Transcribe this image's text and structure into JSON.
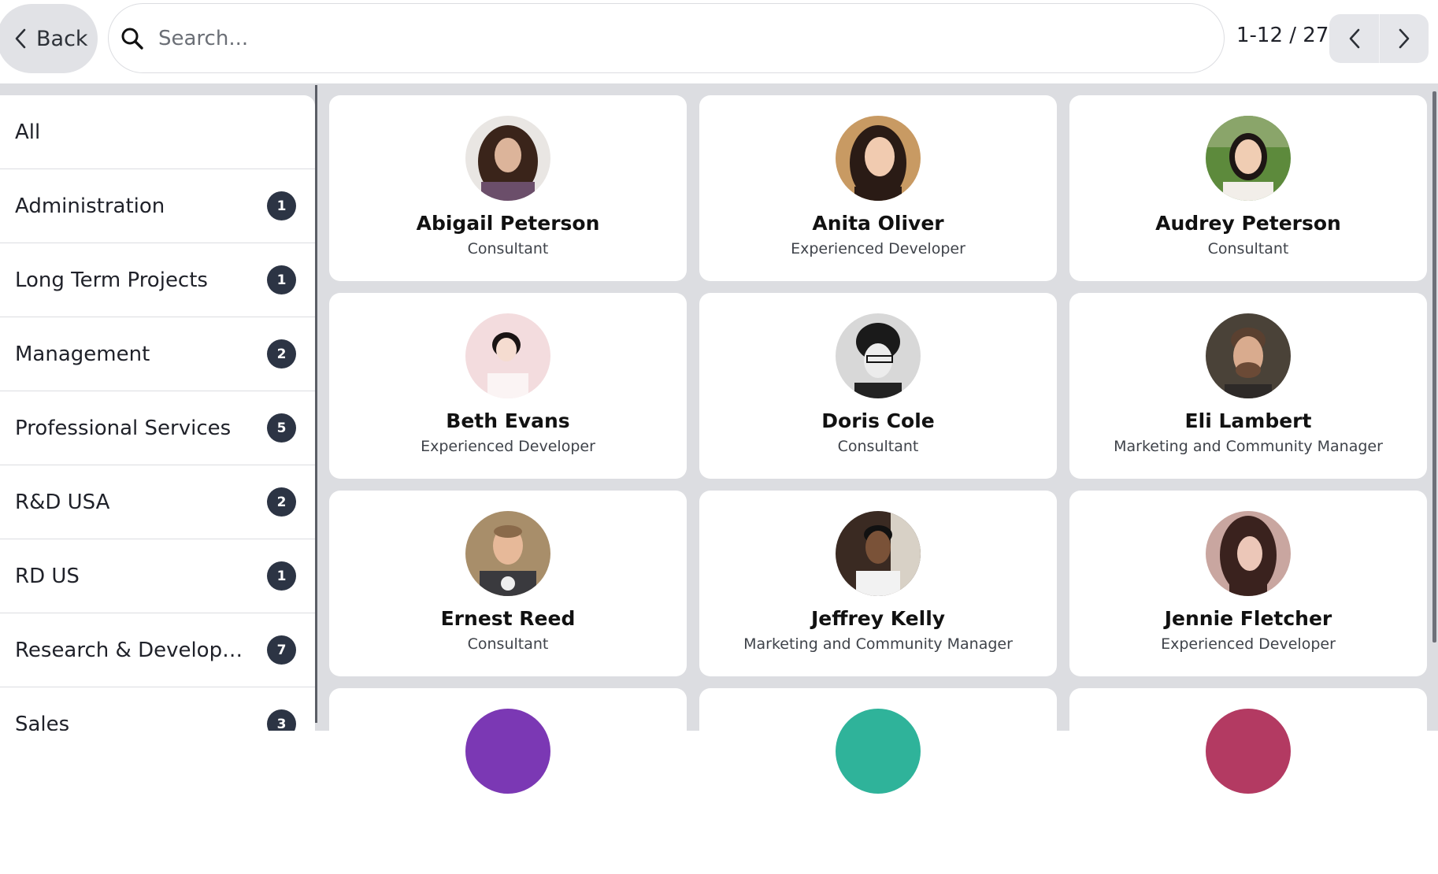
{
  "header": {
    "back_label": "Back",
    "search_placeholder": "Search...",
    "pager": "1-12 / 27"
  },
  "sidebar": {
    "items": [
      {
        "label": "All",
        "count": ""
      },
      {
        "label": "Administration",
        "count": "1"
      },
      {
        "label": "Long Term Projects",
        "count": "1"
      },
      {
        "label": "Management",
        "count": "2"
      },
      {
        "label": "Professional Services",
        "count": "5"
      },
      {
        "label": "R&D USA",
        "count": "2"
      },
      {
        "label": "RD US",
        "count": "1"
      },
      {
        "label": "Research & Development",
        "count": "7"
      },
      {
        "label": "Sales",
        "count": "3"
      }
    ]
  },
  "employees": [
    {
      "name": "Abigail Peterson",
      "job": "Consultant",
      "avatar": "photo-curly-hair-woman"
    },
    {
      "name": "Anita Oliver",
      "job": "Experienced Developer",
      "avatar": "photo-smiling-woman"
    },
    {
      "name": "Audrey Peterson",
      "job": "Consultant",
      "avatar": "photo-woman-outdoors"
    },
    {
      "name": "Beth Evans",
      "job": "Experienced Developer",
      "avatar": "photo-woman-pink-bg"
    },
    {
      "name": "Doris Cole",
      "job": "Consultant",
      "avatar": "photo-woman-beanie-glasses"
    },
    {
      "name": "Eli Lambert",
      "job": "Marketing and Community Manager",
      "avatar": "photo-bearded-man"
    },
    {
      "name": "Ernest Reed",
      "job": "Consultant",
      "avatar": "photo-man-smiling"
    },
    {
      "name": "Jeffrey Kelly",
      "job": "Marketing and Community Manager",
      "avatar": "photo-man-white-shirt"
    },
    {
      "name": "Jennie Fletcher",
      "job": "Experienced Developer",
      "avatar": "photo-woman-dark-hair"
    },
    {
      "name": "",
      "job": "",
      "avatar": "avatar-purple"
    },
    {
      "name": "",
      "job": "",
      "avatar": "avatar-teal"
    },
    {
      "name": "",
      "job": "",
      "avatar": "avatar-crimson"
    }
  ],
  "colors": {
    "background": "#dcdde1",
    "badge": "#2c3444",
    "purple": "#7b38b4",
    "teal": "#2fb39a",
    "crimson": "#b33a62"
  }
}
